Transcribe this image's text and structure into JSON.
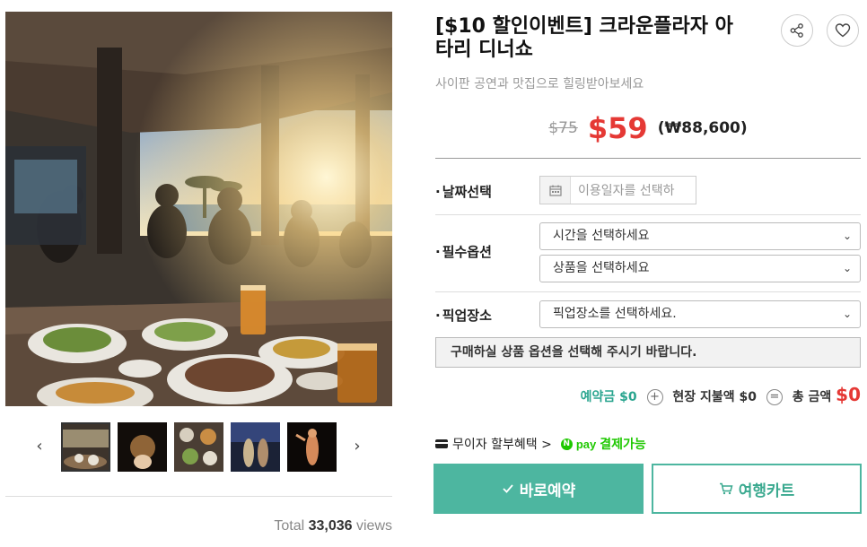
{
  "product": {
    "title": "[$10 할인이벤트] 크라운플라자 아타리 디너쇼",
    "subtitle": "사이판 공연과 맛집으로 힐링받아보세요"
  },
  "price": {
    "original": "$75",
    "sale": "$59",
    "krw": "(₩88,600)"
  },
  "options": {
    "date_label": "날짜선택",
    "date_placeholder": "이용일자를 선택하",
    "required_label": "필수옵션",
    "time_select": "시간을 선택하세요",
    "product_select": "상품을 선택하세요",
    "pickup_label": "픽업장소",
    "pickup_select": "픽업장소를 선택하세요."
  },
  "notice": "구매하실 상품 옵션을 선택해 주시기 바랍니다.",
  "totals": {
    "deposit_label": "예약금",
    "deposit_value": "$0",
    "onsite_label": "현장 지불액",
    "onsite_value": "$0",
    "total_label": "총 금액",
    "total_value": "$0"
  },
  "payment": {
    "installment": "무이자 할부혜택",
    "installment_arrow": ">",
    "npay_text": "pay",
    "npay_label": "결제가능"
  },
  "buttons": {
    "book": "바로예약",
    "cart": "여행카트"
  },
  "gallery": {
    "prev": "‹",
    "next": "›",
    "views_prefix": "Total",
    "views_count": "33,036",
    "views_suffix": "views"
  },
  "icons": {
    "share": "share-icon",
    "like": "heart-icon",
    "calendar": "calendar-icon",
    "check": "check-icon",
    "cart": "cart-icon",
    "card": "card-icon"
  },
  "colors": {
    "accent": "#4db6a0",
    "accent_text": "#2aa58f",
    "sale_red": "#e53935",
    "npay_green": "#1ec800"
  }
}
